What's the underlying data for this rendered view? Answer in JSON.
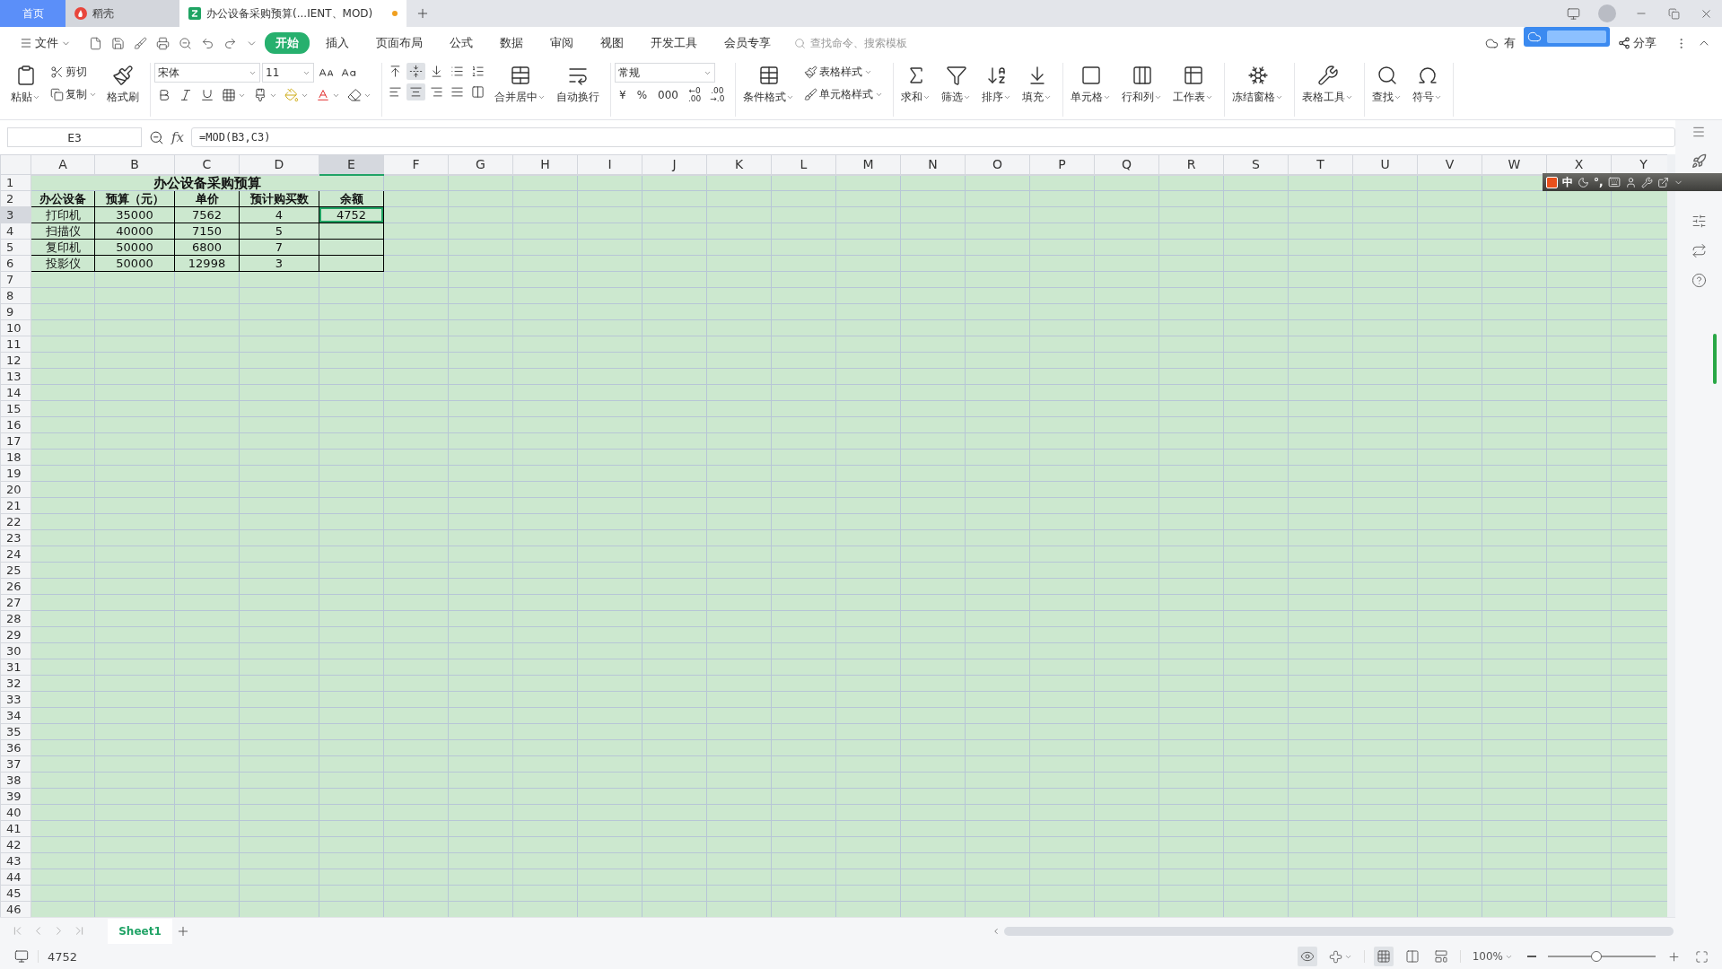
{
  "tabs": [
    {
      "label": "首页",
      "kind": "home",
      "selected": false
    },
    {
      "label": "稻壳",
      "kind": "docer",
      "selected": false
    },
    {
      "label": "办公设备采购预算(...IENT、MOD)",
      "kind": "sheet",
      "selected": true,
      "unsaved": true
    }
  ],
  "menu": {
    "file": "文件",
    "tabs": [
      {
        "label": "开始",
        "selected": true
      },
      {
        "label": "插入",
        "selected": false
      },
      {
        "label": "页面布局",
        "selected": false
      },
      {
        "label": "公式",
        "selected": false
      },
      {
        "label": "数据",
        "selected": false
      },
      {
        "label": "审阅",
        "selected": false
      },
      {
        "label": "视图",
        "selected": false
      },
      {
        "label": "开发工具",
        "selected": false
      },
      {
        "label": "会员专享",
        "selected": false
      }
    ],
    "search": {
      "placeholder": "查找命令、搜索模板"
    },
    "cloud_status": "有",
    "share": "分享"
  },
  "ribbon": {
    "clipboard": {
      "paste": "粘贴",
      "cut": "剪切",
      "copy": "复制",
      "format_painter": "格式刷"
    },
    "font": {
      "name": "宋体",
      "size": "11"
    },
    "vertical_align": [
      {
        "selected": false
      },
      {
        "selected": true
      },
      {
        "selected": false
      }
    ],
    "horizontal_align": [
      {
        "selected": false
      },
      {
        "selected": true
      },
      {
        "selected": false
      },
      {
        "selected": false
      }
    ],
    "merge": "合并居中",
    "wrap": "自动换行",
    "number_format": "常规",
    "currency": "¥",
    "percent": "%",
    "thousands": "000",
    "decimal_buttons": [
      [
        "←0",
        ".00"
      ],
      [
        ".00",
        "→.0"
      ]
    ],
    "conditional": "条件格式",
    "styles": [
      "表格样式",
      "单元格样式"
    ],
    "tool_groups": [
      [
        "求和",
        "筛选",
        "排序",
        "填充"
      ],
      [
        "单元格",
        "行和列",
        "工作表"
      ],
      [
        "冻结窗格"
      ],
      [
        "表格工具"
      ],
      [
        "查找",
        "符号"
      ]
    ]
  },
  "formula_bar": {
    "cell_ref": "E3",
    "fx": "fx",
    "formula": "=MOD(B3,C3)"
  },
  "sheet": {
    "columns": [
      {
        "label": "A",
        "selected": false
      },
      {
        "label": "B",
        "selected": false
      },
      {
        "label": "C",
        "selected": false
      },
      {
        "label": "D",
        "selected": false
      },
      {
        "label": "E",
        "selected": true
      },
      {
        "label": "F",
        "selected": false
      },
      {
        "label": "G",
        "selected": false
      },
      {
        "label": "H",
        "selected": false
      },
      {
        "label": "I",
        "selected": false
      },
      {
        "label": "J",
        "selected": false
      },
      {
        "label": "K",
        "selected": false
      },
      {
        "label": "L",
        "selected": false
      },
      {
        "label": "M",
        "selected": false
      },
      {
        "label": "N",
        "selected": false
      },
      {
        "label": "O",
        "selected": false
      },
      {
        "label": "P",
        "selected": false
      },
      {
        "label": "Q",
        "selected": false
      },
      {
        "label": "R",
        "selected": false
      },
      {
        "label": "S",
        "selected": false
      },
      {
        "label": "T",
        "selected": false
      },
      {
        "label": "U",
        "selected": false
      },
      {
        "label": "V",
        "selected": false
      },
      {
        "label": "W",
        "selected": false
      },
      {
        "label": "X",
        "selected": false
      },
      {
        "label": "Y",
        "selected": false
      }
    ],
    "row_numbers": [
      {
        "label": "1",
        "selected": false
      },
      {
        "label": "2",
        "selected": false
      },
      {
        "label": "3",
        "selected": true
      },
      {
        "label": "4",
        "selected": false
      },
      {
        "label": "5",
        "selected": false
      },
      {
        "label": "6",
        "selected": false
      },
      {
        "label": "7",
        "selected": false
      },
      {
        "label": "8",
        "selected": false
      },
      {
        "label": "9",
        "selected": false
      },
      {
        "label": "10",
        "selected": false
      },
      {
        "label": "11",
        "selected": false
      },
      {
        "label": "12",
        "selected": false
      },
      {
        "label": "13",
        "selected": false
      },
      {
        "label": "14",
        "selected": false
      },
      {
        "label": "15",
        "selected": false
      },
      {
        "label": "16",
        "selected": false
      },
      {
        "label": "17",
        "selected": false
      },
      {
        "label": "18",
        "selected": false
      },
      {
        "label": "19",
        "selected": false
      },
      {
        "label": "20",
        "selected": false
      },
      {
        "label": "21",
        "selected": false
      },
      {
        "label": "22",
        "selected": false
      },
      {
        "label": "23",
        "selected": false
      },
      {
        "label": "24",
        "selected": false
      },
      {
        "label": "25",
        "selected": false
      },
      {
        "label": "26",
        "selected": false
      },
      {
        "label": "27",
        "selected": false
      },
      {
        "label": "28",
        "selected": false
      },
      {
        "label": "29",
        "selected": false
      },
      {
        "label": "30",
        "selected": false
      },
      {
        "label": "31",
        "selected": false
      },
      {
        "label": "32",
        "selected": false
      },
      {
        "label": "33",
        "selected": false
      },
      {
        "label": "34",
        "selected": false
      },
      {
        "label": "35",
        "selected": false
      },
      {
        "label": "36",
        "selected": false
      },
      {
        "label": "37",
        "selected": false
      },
      {
        "label": "38",
        "selected": false
      },
      {
        "label": "39",
        "selected": false
      },
      {
        "label": "40",
        "selected": false
      },
      {
        "label": "41",
        "selected": false
      },
      {
        "label": "42",
        "selected": false
      },
      {
        "label": "43",
        "selected": false
      },
      {
        "label": "44",
        "selected": false
      },
      {
        "label": "45",
        "selected": false
      },
      {
        "label": "46",
        "selected": false
      }
    ],
    "title": "办公设备采购预算",
    "header": [
      "办公设备",
      "预算（元）",
      "单价",
      "预计购买数",
      "余额"
    ],
    "rows": [
      [
        "打印机",
        "35000",
        "7562",
        "4",
        "4752"
      ],
      [
        "扫描仪",
        "40000",
        "7150",
        "5"
      ],
      [
        "复印机",
        "50000",
        "6800",
        "7"
      ],
      [
        "投影仪",
        "50000",
        "12998",
        "3"
      ]
    ]
  },
  "sheet_tabs": [
    {
      "label": "Sheet1",
      "selected": true
    }
  ],
  "ime": {
    "mode": "中",
    "punctuation": "°,"
  },
  "status": {
    "value": "4752",
    "eye_mode": {
      "on": true
    },
    "views": [
      {
        "selected": true
      },
      {
        "selected": false
      },
      {
        "selected": false
      }
    ],
    "zoom": "100%",
    "zoom_level": {
      "level": 0.45
    }
  }
}
